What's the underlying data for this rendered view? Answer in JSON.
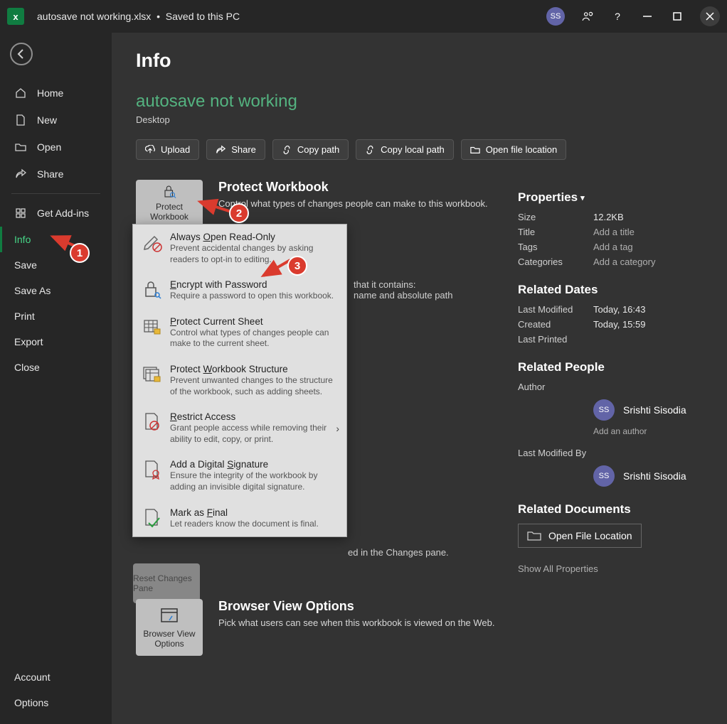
{
  "titlebar": {
    "filename": "autosave not working.xlsx",
    "status": "Saved to this PC",
    "user_initials": "SS"
  },
  "nav": {
    "home": "Home",
    "new": "New",
    "open": "Open",
    "share": "Share",
    "addins": "Get Add-ins",
    "info": "Info",
    "save": "Save",
    "saveas": "Save As",
    "print": "Print",
    "export": "Export",
    "close": "Close",
    "account": "Account",
    "options": "Options"
  },
  "page": {
    "title": "Info",
    "doc_title": "autosave not working",
    "doc_location": "Desktop"
  },
  "actions": {
    "upload": "Upload",
    "share": "Share",
    "copypath": "Copy path",
    "copylocal": "Copy local path",
    "openloc": "Open file location"
  },
  "protect": {
    "btn": "Protect Workbook",
    "heading": "Protect Workbook",
    "desc": "Control what types of changes people can make to this workbook."
  },
  "menu": {
    "readonly_title": "Always Open Read-Only",
    "readonly_desc": "Prevent accidental changes by asking readers to opt-in to editing.",
    "encrypt_title": "Encrypt with Password",
    "encrypt_desc": "Require a password to open this workbook.",
    "sheet_title": "Protect Current Sheet",
    "sheet_desc": "Control what types of changes people can make to the current sheet.",
    "struct_title": "Protect Workbook Structure",
    "struct_desc": "Prevent unwanted changes to the structure of the workbook, such as adding sheets.",
    "restrict_title": "Restrict Access",
    "restrict_desc": "Grant people access while removing their ability to edit, copy, or print.",
    "sig_title": "Add a Digital Signature",
    "sig_desc": "Ensure the integrity of the workbook by adding an invisible digital signature.",
    "final_title": "Mark as Final",
    "final_desc": "Let readers know the document is final."
  },
  "hidden": {
    "line1": "that it contains:",
    "line2": "name and absolute path",
    "changes_note": "ed in the Changes pane.",
    "reset_btn": "Reset Changes Pane"
  },
  "browser": {
    "btn": "Browser View Options",
    "heading": "Browser View Options",
    "desc": "Pick what users can see when this workbook is viewed on the Web."
  },
  "props": {
    "header": "Properties",
    "size_l": "Size",
    "size_v": "12.2KB",
    "title_l": "Title",
    "title_v": "Add a title",
    "tags_l": "Tags",
    "tags_v": "Add a tag",
    "cat_l": "Categories",
    "cat_v": "Add a category",
    "dates_header": "Related Dates",
    "mod_l": "Last Modified",
    "mod_v": "Today, 16:43",
    "created_l": "Created",
    "created_v": "Today, 15:59",
    "printed_l": "Last Printed",
    "people_header": "Related People",
    "author_l": "Author",
    "author_name": "Srishti Sisodia",
    "author_initials": "SS",
    "add_author": "Add an author",
    "modby_l": "Last Modified By",
    "modby_name": "Srishti Sisodia",
    "modby_initials": "SS",
    "docs_header": "Related Documents",
    "open_loc": "Open File Location",
    "show_all": "Show All Properties"
  },
  "annotations": {
    "n1": "1",
    "n2": "2",
    "n3": "3"
  }
}
